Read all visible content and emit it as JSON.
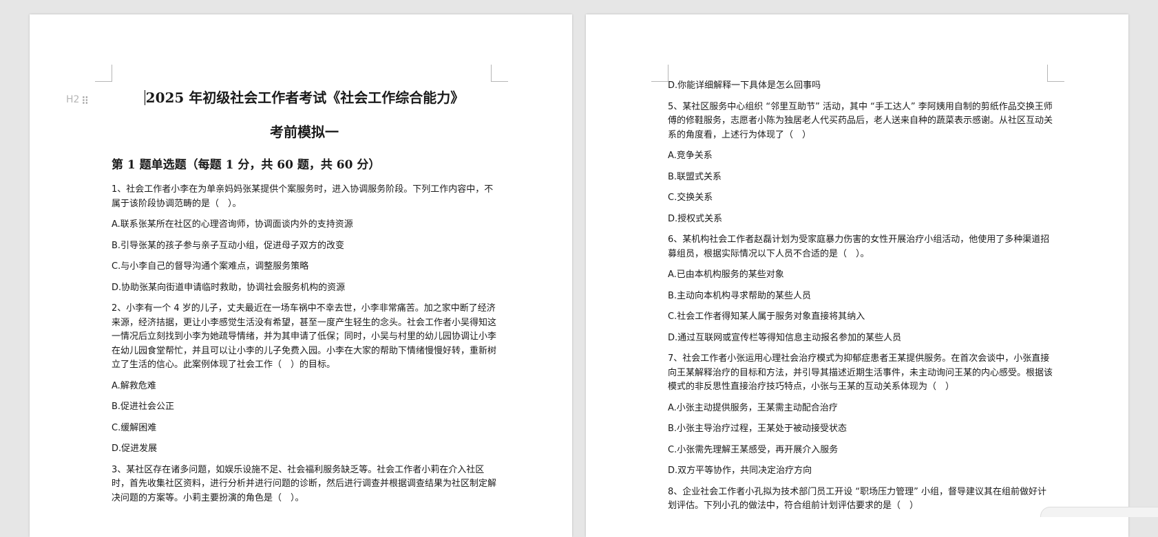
{
  "left_page": {
    "heading_tag": "H2",
    "title": "2025 年初级社会工作者考试《社会工作综合能力》",
    "subtitle": "考前模拟一",
    "section": "第 1 题单选题（每题 1 分，共 60 题，共 60 分）",
    "items": [
      {
        "kind": "q",
        "text": "1、社会工作者小李在为单亲妈妈张某提供个案服务时，进入协调服务阶段。下列工作内容中，不属于该阶段协调范畴的是（　）。"
      },
      {
        "kind": "opt",
        "text": "A.联系张某所在社区的心理咨询师，协调面谈内外的支持资源"
      },
      {
        "kind": "opt",
        "text": "B.引导张某的孩子参与亲子互动小组，促进母子双方的改变"
      },
      {
        "kind": "opt",
        "text": "C.与小李自己的督导沟通个案难点，调整服务策略"
      },
      {
        "kind": "opt",
        "text": "D.协助张某向街道申请临时救助，协调社会服务机构的资源"
      },
      {
        "kind": "q",
        "text": "2、小李有一个 4 岁的儿子，丈夫最近在一场车祸中不幸去世，小李非常痛苦。加之家中断了经济来源，经济拮据，更让小李感觉生活没有希望，甚至一度产生轻生的念头。社会工作者小吴得知这一情况后立刻找到小李为她疏导情绪，并为其申请了低保；同时，小吴与村里的幼儿园协调让小李在幼儿园食堂帮忙，并且可以让小李的儿子免费入园。小李在大家的帮助下情绪慢慢好转，重新树立了生活的信心。此案例体现了社会工作（　）的目标。"
      },
      {
        "kind": "opt",
        "text": "A.解救危难"
      },
      {
        "kind": "opt",
        "text": "B.促进社会公正"
      },
      {
        "kind": "opt",
        "text": "C.缓解困难"
      },
      {
        "kind": "opt",
        "text": "D.促进发展"
      },
      {
        "kind": "q",
        "text": "3、某社区存在诸多问题，如娱乐设施不足、社会福利服务缺乏等。社会工作者小莉在介入社区时，首先收集社区资料，进行分析并进行问题的诊断，然后进行调查并根据调查结果为社区制定解决问题的方案等。小莉主要扮演的角色是（　）。"
      }
    ]
  },
  "right_page": {
    "items": [
      {
        "kind": "opt",
        "text": "D.你能详细解释一下具体是怎么回事吗"
      },
      {
        "kind": "q",
        "text": "5、某社区服务中心组织 “邻里互助节” 活动，其中 “手工达人” 李阿姨用自制的剪纸作品交换王师傅的修鞋服务，志愿者小陈为独居老人代买药品后，老人送来自种的蔬菜表示感谢。从社区互动关系的角度看，上述行为体现了（　）"
      },
      {
        "kind": "opt",
        "text": "A.竞争关系"
      },
      {
        "kind": "opt",
        "text": "B.联盟式关系"
      },
      {
        "kind": "opt",
        "text": "C.交换关系"
      },
      {
        "kind": "opt",
        "text": "D.授权式关系"
      },
      {
        "kind": "q",
        "text": "6、某机构社会工作者赵磊计划为受家庭暴力伤害的女性开展治疗小组活动，他使用了多种渠道招募组员，根据实际情况以下人员不合适的是（　）。"
      },
      {
        "kind": "opt",
        "text": "A.已由本机构服务的某些对象"
      },
      {
        "kind": "opt",
        "text": "B.主动向本机构寻求帮助的某些人员"
      },
      {
        "kind": "opt",
        "text": "C.社会工作者得知某人属于服务对象直接将其纳入"
      },
      {
        "kind": "opt",
        "text": "D.通过互联网或宣传栏等得知信息主动报名参加的某些人员"
      },
      {
        "kind": "q",
        "text": "7、社会工作者小张运用心理社会治疗模式为抑郁症患者王某提供服务。在首次会谈中，小张直接向王某解释治疗的目标和方法，并引导其描述近期生活事件，未主动询问王某的内心感受。根据该模式的非反思性直接治疗技巧特点，小张与王某的互动关系体现为（　）"
      },
      {
        "kind": "opt",
        "text": "A.小张主动提供服务，王某需主动配合治疗"
      },
      {
        "kind": "opt",
        "text": "B.小张主导治疗过程，王某处于被动接受状态"
      },
      {
        "kind": "opt",
        "text": "C.小张需先理解王某感受，再开展介入服务"
      },
      {
        "kind": "opt",
        "text": "D.双方平等协作，共同决定治疗方向"
      },
      {
        "kind": "q",
        "text": "8、企业社会工作者小孔拟为技术部门员工开设 “职场压力管理” 小组，督导建议其在组前做好计划评估。下列小孔的做法中，符合组前计划评估要求的是（　）"
      }
    ]
  }
}
